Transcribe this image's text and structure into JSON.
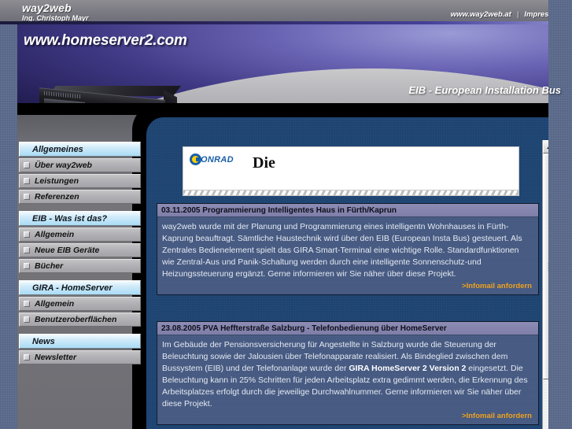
{
  "topbar": {
    "brand_name": "way2web",
    "brand_subtitle": "Ing. Christoph Mayr",
    "link_site": "www.way2web.at",
    "separator": "|",
    "link_impressum": "Impressum"
  },
  "hero": {
    "title": "www.homeserver2.com",
    "strapline": "EIB - European Installation Bus",
    "device_alt": "homeserver-appliance"
  },
  "sidebar": {
    "groups": [
      {
        "heading": "Allgemeines",
        "items": [
          {
            "label": "Über way2web"
          },
          {
            "label": "Leistungen"
          },
          {
            "label": "Referenzen"
          }
        ]
      },
      {
        "heading": "EIB - Was ist das?",
        "items": [
          {
            "label": "Allgemein"
          },
          {
            "label": "Neue EIB Geräte"
          },
          {
            "label": "Bücher"
          }
        ]
      },
      {
        "heading": "GIRA - HomeServer",
        "items": [
          {
            "label": "Allgemein"
          },
          {
            "label": "Benutzeroberflächen"
          }
        ]
      },
      {
        "heading": "News",
        "items": [
          {
            "label": "Newsletter"
          }
        ]
      }
    ]
  },
  "advert": {
    "logo_word": "ONRAD",
    "headline": "Die"
  },
  "news": [
    {
      "date": "03.11.2005",
      "title": "Programmierung Intelligentes Haus in Fürth/Kaprun",
      "body": "way2web wurde mit der Planung und Programmierung eines intelligentn Wohnhauses in Fürth-Kaprung beauftragt. Sämtliche Haustechnik wird über den EIB (European Insta Bus) gesteuert. Als Zentrales Bedienelement spielt das GIRA Smart-Terminal eine wichtige Rolle. Standardfunktionen wie Zentral-Aus und Panik-Schaltung werden durch eine intelligente Sonnenschutz-und Heizungssteuerung ergänzt. Gerne informieren wir Sie näher über diese Projekt.",
      "link": ">Infomail anfordern"
    },
    {
      "date": "23.08.2005",
      "title": "PVA Heffterstraße Salzburg - Telefonbedienung über HomeServer",
      "body": "Im Gebäude der Pensionsversicherung für Angestellte in Salzburg wurde die Steuerung der Beleuchtung sowie der Jalousien über Telefonapparate realisiert. Als Bindeglied zwischen dem Bussystem (EIB) und der Telefonanlage wurde der GIRA HomeServer 2 Version 2 eingesetzt. Die Beleuchtung kann in 25% Schritten für jeden Arbeitsplatz extra gedimmt werden, die Erkennung des Arbeitsplatzes erfolgt durch die jeweilige Durchwahlnummer. Gerne informieren wir Sie näher über diese Projekt.",
      "bold_phrase": "GIRA HomeServer 2 Version 2",
      "link": ">Infomail anfordern"
    }
  ],
  "scrollbar": {
    "up_arrow": "scroll-up-arrow"
  },
  "colors": {
    "panel_blue": "#1d4371",
    "news_bg": "#465a82",
    "news_header": "#8d8cb4",
    "link_orange": "#f0a21e",
    "nav_heading": "#a9dcf6",
    "page_bg": "#5c6b8c"
  }
}
